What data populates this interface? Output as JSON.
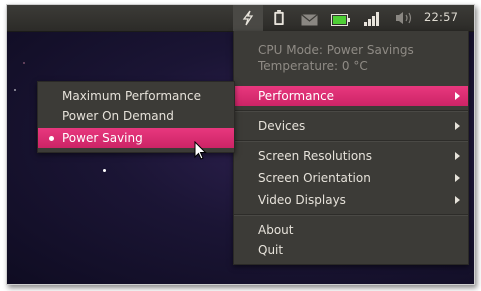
{
  "topbar": {
    "clock": "22:57",
    "icons": [
      "power-plug-icon",
      "battery-icon",
      "mail-icon",
      "display-battery-icon",
      "network-signal-icon",
      "volume-icon"
    ]
  },
  "main_menu": {
    "cpu_mode": "CPU Mode: Power Savings",
    "temperature": "Temperature: 0 °C",
    "items": [
      {
        "label": "Performance",
        "has_submenu": true,
        "highlighted": true
      },
      {
        "label": "Devices",
        "has_submenu": true
      },
      {
        "label": "Screen Resolutions",
        "has_submenu": true
      },
      {
        "label": "Screen Orientation",
        "has_submenu": true
      },
      {
        "label": "Video Displays",
        "has_submenu": true
      },
      {
        "label": "About",
        "has_submenu": false
      },
      {
        "label": "Quit",
        "has_submenu": false
      }
    ]
  },
  "submenu": {
    "items": [
      {
        "label": "Maximum Performance",
        "selected": false
      },
      {
        "label": "Power On Demand",
        "selected": false
      },
      {
        "label": "Power Saving",
        "selected": true,
        "highlighted": true
      }
    ]
  },
  "colors": {
    "highlight": "#e02d74",
    "menu_bg": "#3c3b37",
    "panel_bg": "#3c3b37",
    "desktop": "#1b1535"
  }
}
